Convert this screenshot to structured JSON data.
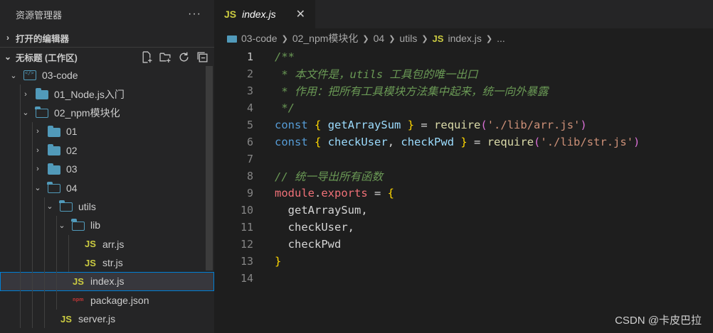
{
  "sidebar": {
    "title": "资源管理器",
    "more": "···",
    "open_editors": "打开的编辑器",
    "workspace": "无标题 (工作区)",
    "tree": [
      {
        "label": "03-code",
        "indent": 1,
        "twisty": "⌄",
        "icon": "code-folder"
      },
      {
        "label": "01_Node.js入门",
        "indent": 2,
        "twisty": "›",
        "icon": "folder"
      },
      {
        "label": "02_npm模块化",
        "indent": 2,
        "twisty": "⌄",
        "icon": "folder-open"
      },
      {
        "label": "01",
        "indent": 3,
        "twisty": "›",
        "icon": "folder"
      },
      {
        "label": "02",
        "indent": 3,
        "twisty": "›",
        "icon": "folder"
      },
      {
        "label": "03",
        "indent": 3,
        "twisty": "›",
        "icon": "folder"
      },
      {
        "label": "04",
        "indent": 3,
        "twisty": "⌄",
        "icon": "folder-open"
      },
      {
        "label": "utils",
        "indent": 4,
        "twisty": "⌄",
        "icon": "folder-open"
      },
      {
        "label": "lib",
        "indent": 5,
        "twisty": "⌄",
        "icon": "folder-open"
      },
      {
        "label": "arr.js",
        "indent": 6,
        "twisty": "",
        "icon": "js"
      },
      {
        "label": "str.js",
        "indent": 6,
        "twisty": "",
        "icon": "js"
      },
      {
        "label": "index.js",
        "indent": 5,
        "twisty": "",
        "icon": "js",
        "selected": true
      },
      {
        "label": "package.json",
        "indent": 5,
        "twisty": "",
        "icon": "npm"
      },
      {
        "label": "server.js",
        "indent": 4,
        "twisty": "",
        "icon": "js"
      }
    ]
  },
  "tab": {
    "icon": "JS",
    "name": "index.js",
    "close": "✕"
  },
  "breadcrumb": [
    "03-code",
    "02_npm模块化",
    "04",
    "utils",
    "index.js",
    "..."
  ],
  "code_lines": [
    {
      "n": "1",
      "tokens": [
        [
          "c-com",
          "/**"
        ]
      ]
    },
    {
      "n": "2",
      "tokens": [
        [
          "c-com",
          " * 本文件是，utils 工具包的唯一出口"
        ]
      ]
    },
    {
      "n": "3",
      "tokens": [
        [
          "c-com",
          " * 作用：把所有工具模块方法集中起来，统一向外暴露"
        ]
      ]
    },
    {
      "n": "4",
      "tokens": [
        [
          "c-com",
          " */"
        ]
      ]
    },
    {
      "n": "5",
      "tokens": [
        [
          "c-kw",
          "const"
        ],
        [
          "c-plain",
          " "
        ],
        [
          "c-br",
          "{"
        ],
        [
          "c-plain",
          " "
        ],
        [
          "c-var",
          "getArraySum"
        ],
        [
          "c-plain",
          " "
        ],
        [
          "c-br",
          "}"
        ],
        [
          "c-plain",
          " = "
        ],
        [
          "c-fn",
          "require"
        ],
        [
          "c-paren",
          "("
        ],
        [
          "c-str",
          "'./lib/arr.js'"
        ],
        [
          "c-paren",
          ")"
        ]
      ]
    },
    {
      "n": "6",
      "tokens": [
        [
          "c-kw",
          "const"
        ],
        [
          "c-plain",
          " "
        ],
        [
          "c-br",
          "{"
        ],
        [
          "c-plain",
          " "
        ],
        [
          "c-var",
          "checkUser"
        ],
        [
          "c-plain",
          ", "
        ],
        [
          "c-var",
          "checkPwd"
        ],
        [
          "c-plain",
          " "
        ],
        [
          "c-br",
          "}"
        ],
        [
          "c-plain",
          " = "
        ],
        [
          "c-fn",
          "require"
        ],
        [
          "c-paren",
          "("
        ],
        [
          "c-str",
          "'./lib/str.js'"
        ],
        [
          "c-paren",
          ")"
        ]
      ]
    },
    {
      "n": "7",
      "tokens": []
    },
    {
      "n": "8",
      "tokens": [
        [
          "c-com",
          "// 统一导出所有函数"
        ]
      ]
    },
    {
      "n": "9",
      "tokens": [
        [
          "c-mod",
          "module"
        ],
        [
          "c-plain",
          "."
        ],
        [
          "c-mod",
          "exports"
        ],
        [
          "c-plain",
          " = "
        ],
        [
          "c-br",
          "{"
        ]
      ]
    },
    {
      "n": "10",
      "tokens": [
        [
          "c-plain",
          "  getArraySum,"
        ]
      ]
    },
    {
      "n": "11",
      "tokens": [
        [
          "c-plain",
          "  checkUser,"
        ]
      ]
    },
    {
      "n": "12",
      "tokens": [
        [
          "c-plain",
          "  checkPwd"
        ]
      ]
    },
    {
      "n": "13",
      "tokens": [
        [
          "c-br",
          "}"
        ]
      ]
    },
    {
      "n": "14",
      "tokens": []
    }
  ],
  "watermark": "CSDN @卡皮巴拉"
}
